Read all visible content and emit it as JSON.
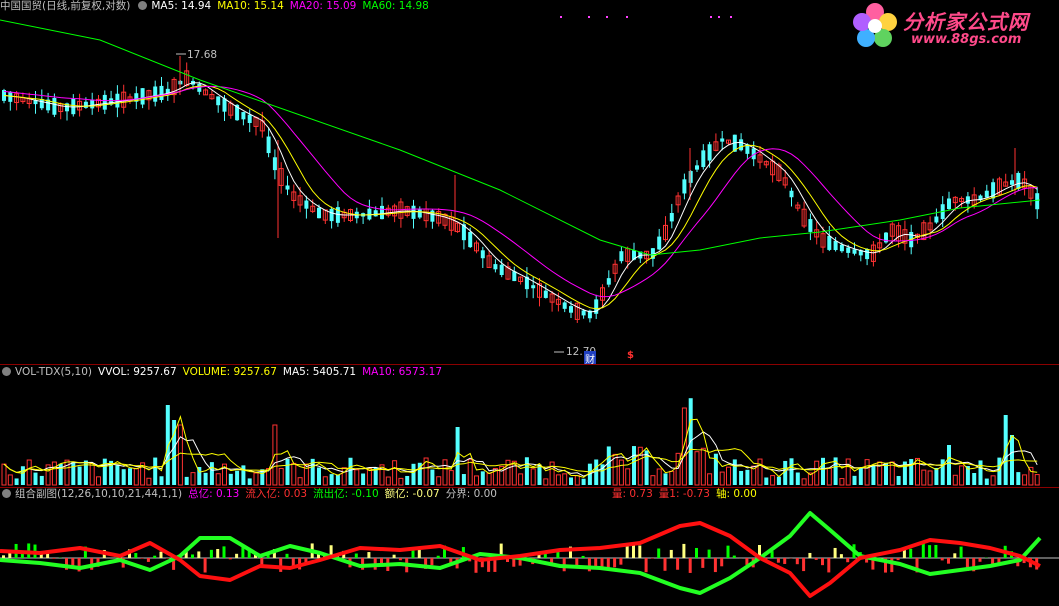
{
  "price_panel": {
    "title": "中国国贸(日线,前复权,对数)",
    "ma5": "MA5: 14.94",
    "ma10": "MA10: 15.14",
    "ma20": "MA20: 15.09",
    "ma60": "MA60: 14.98",
    "high_label": "17.68",
    "low_label": "12.70",
    "marker_cai": "财",
    "marker_s": "$"
  },
  "volume_panel": {
    "title": "VOL-TDX(5,10)",
    "vvol": "VVOL: 9257.67",
    "volume": "VOLUME: 9257.67",
    "ma5": "MA5: 5405.71",
    "ma10": "MA10: 6573.17"
  },
  "sub_panel": {
    "title": "组合副图(12,26,10,10,21,44,1,1)",
    "zong": "总亿: 0.13",
    "liuru": "流入亿: 0.03",
    "liuchu": "流出亿: -0.10",
    "e": "额亿: -0.07",
    "fenjie": "分界: 0.00",
    "liang": "量: 0.73",
    "liang1": "量1: -0.73",
    "zhou": "轴: 0.00"
  },
  "logo": {
    "cn": "分析家公式网",
    "url": "www.88gs.com"
  },
  "colors": {
    "up": "#ff3232",
    "down": "#54ffff",
    "ma5": "#ffffff",
    "ma10": "#ffff00",
    "ma20": "#ff00ff",
    "ma60": "#00ff00",
    "flow_red": "#ff1010",
    "flow_green": "#22ff22",
    "bar_yellow": "#ffff80"
  }
}
